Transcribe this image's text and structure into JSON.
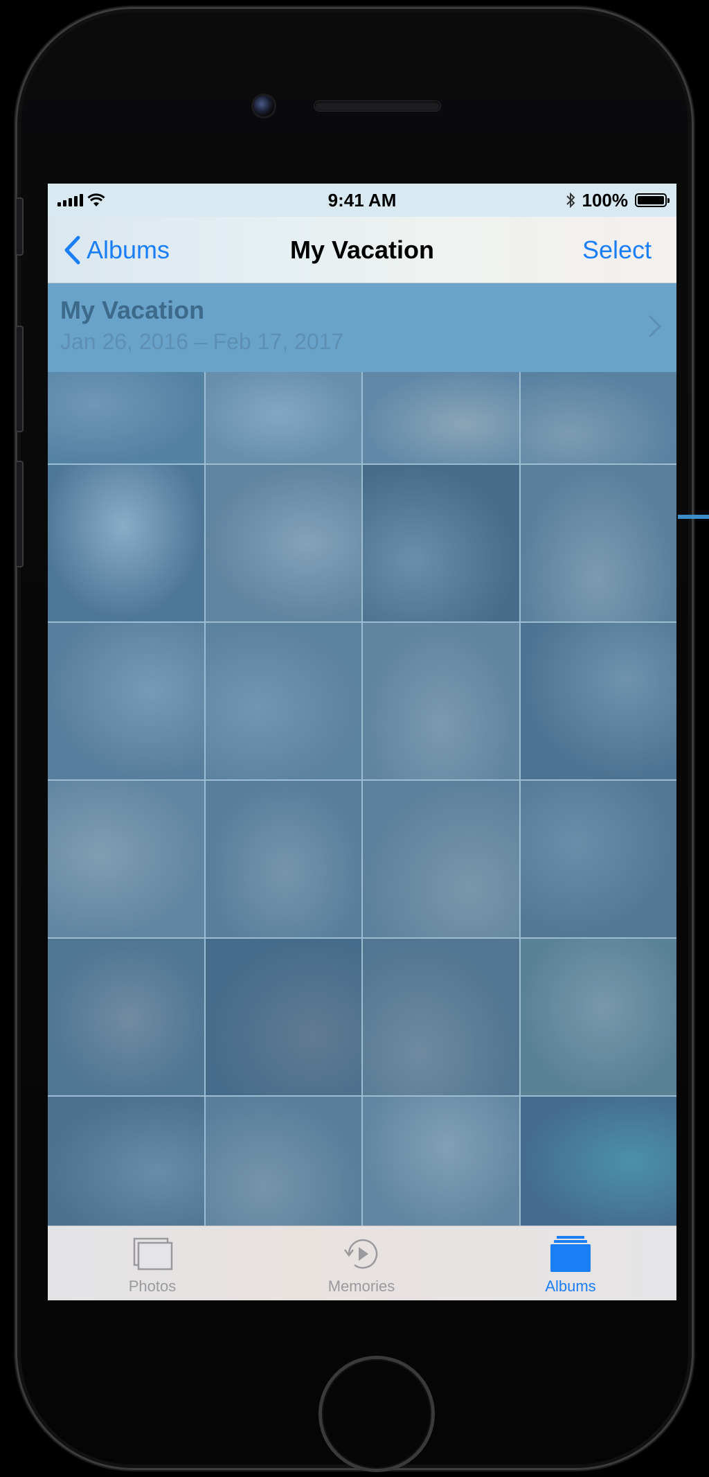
{
  "status_bar": {
    "time": "9:41 AM",
    "battery_percent": "100%",
    "battery_level": 1.0,
    "icons": [
      "signal-icon",
      "wifi-icon",
      "bluetooth-icon",
      "battery-icon"
    ]
  },
  "nav": {
    "back_label": "Albums",
    "title": "My Vacation",
    "select_label": "Select"
  },
  "album": {
    "title": "My Vacation",
    "dates": "Jan 26, 2016 – Feb 17, 2017"
  },
  "photo_count": 24,
  "tabs": [
    {
      "label": "Photos",
      "icon": "photos-icon",
      "selected": false
    },
    {
      "label": "Memories",
      "icon": "memories-icon",
      "selected": false
    },
    {
      "label": "Albums",
      "icon": "albums-icon",
      "selected": true
    }
  ],
  "colors": {
    "accent": "#1a7ef5",
    "overlay": "#6aa3c9",
    "inactive_tab": "#9a9a9e"
  }
}
